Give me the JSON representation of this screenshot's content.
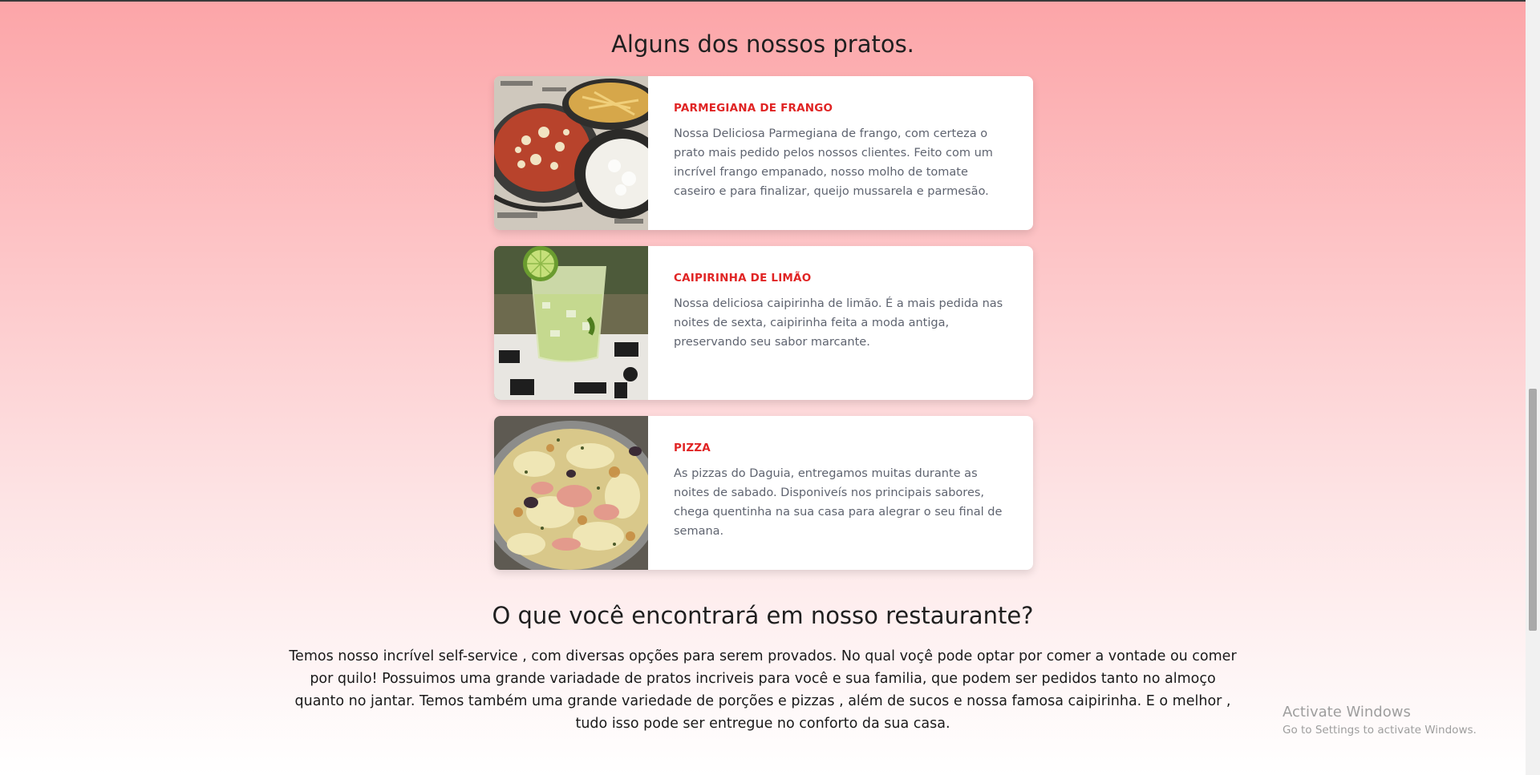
{
  "sections": {
    "dishes_title": "Alguns dos nossos pratos.",
    "about_title": "O que você encontrará em nosso restaurante?",
    "about_text": "Temos nosso incrível self-service , com diversas opções para serem provados. No qual voçê pode optar por comer a vontade ou comer por quilo! Possuimos uma grande variadade de pratos incriveis para você e sua familia, que podem ser pedidos tanto no almoço quanto no jantar. Temos também uma grande variedade de porções e pizzas , além de sucos e nossa famosa caipirinha. E o melhor , tudo isso pode ser entregue no conforto da sua casa."
  },
  "dishes": [
    {
      "title": "PARMEGIANA DE FRANGO",
      "description": "Nossa Deliciosa Parmegiana de frango, com certeza o prato mais pedido pelos nossos clientes. Feito com um incrível frango empanado, nosso molho de tomate caseiro e para finalizar, queijo mussarela e parmesão."
    },
    {
      "title": "CAIPIRINHA DE LIMÃO",
      "description": "Nossa deliciosa caipirinha de limão. É a mais pedida nas noites de sexta, caipirinha feita a moda antiga, preservando seu sabor marcante."
    },
    {
      "title": "PIZZA",
      "description": "As pizzas do Daguia, entregamos muitas durante as noites de sabado. Disponiveís nos principais sabores, chega quentinha na sua casa para alegrar o seu final de semana."
    }
  ],
  "watermark": {
    "line1": "Activate Windows",
    "line2": "Go to Settings to activate Windows."
  },
  "colors": {
    "accent": "#e02424",
    "background_top": "#fca5a8",
    "background_bottom": "#ffffff"
  }
}
